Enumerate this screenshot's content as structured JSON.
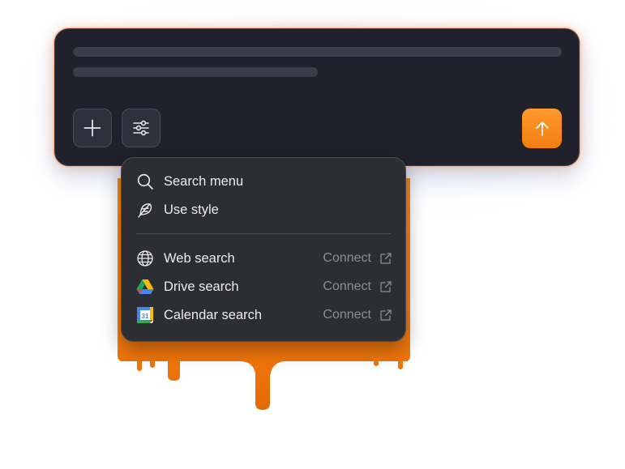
{
  "composer": {
    "add_button": "add",
    "options_button": "options",
    "send_button": "send"
  },
  "menu": {
    "primary_items": [
      {
        "label": "Search menu",
        "icon": "search-icon"
      },
      {
        "label": "Use style",
        "icon": "feather-icon"
      }
    ],
    "connector_items": [
      {
        "label": "Web search",
        "icon": "globe-icon",
        "action": "Connect"
      },
      {
        "label": "Drive search",
        "icon": "google-drive-icon",
        "action": "Connect"
      },
      {
        "label": "Calendar search",
        "icon": "google-calendar-icon",
        "action": "Connect",
        "icon_text": "31"
      }
    ]
  },
  "colors": {
    "composer_bg": "#20212b",
    "menu_bg": "#2d2e33",
    "accent_orange": "#f7851a",
    "connect_text": "#8b8c95"
  }
}
